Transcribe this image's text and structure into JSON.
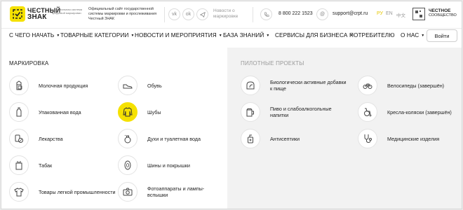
{
  "header": {
    "logo_text_line1": "ЧЕСТНЫЙ",
    "logo_text_line2": "ЗНАК",
    "logo_sub": "национальная система цифровой маркировки",
    "tagline": "Официальный сайт государственной системы маркировки и прослеживания Честный ЗНАК",
    "news_text": "Новости о маркировке",
    "phone": "8 800 222 1523",
    "email": "support@crpt.ru",
    "lang_ru": "РУ",
    "lang_en": "EN",
    "lang_zh": "中文",
    "cs_line1": "ЧЕСТНОЕ",
    "cs_line2": "СООБЩЕСТВО"
  },
  "nav": {
    "items": [
      "С ЧЕГО НАЧАТЬ",
      "ТОВАРНЫЕ КАТЕГОРИИ",
      "НОВОСТИ И МЕРОПРИЯТИЯ",
      "БАЗА ЗНАНИЙ",
      "СЕРВИСЫ ДЛЯ БИЗНЕСА",
      "ПОТРЕБИТЕЛЮ",
      "О НАС"
    ],
    "login": "Войти"
  },
  "left": {
    "title": "МАРКИРОВКА",
    "col1": [
      {
        "label": "Молочная продукция",
        "icon": "milk-icon"
      },
      {
        "label": "Упакованная вода",
        "icon": "water-bottle-icon"
      },
      {
        "label": "Лекарства",
        "icon": "medicine-icon"
      },
      {
        "label": "Табак",
        "icon": "tobacco-icon"
      },
      {
        "label": "Товары легкой промышленности",
        "icon": "tshirt-icon"
      }
    ],
    "col2": [
      {
        "label": "Обувь",
        "icon": "shoe-icon"
      },
      {
        "label": "Шубы",
        "icon": "fur-coat-icon"
      },
      {
        "label": "Духи и туалетная вода",
        "icon": "perfume-icon"
      },
      {
        "label": "Шины и покрышки",
        "icon": "tire-icon"
      },
      {
        "label": "Фотоаппараты и лампы-вспышки",
        "icon": "camera-icon"
      }
    ]
  },
  "right": {
    "title": "ПИЛОТНЫЕ ПРОЕКТЫ",
    "col1": [
      {
        "label": "Биологически активные добавки к пище",
        "icon": "supplement-icon"
      },
      {
        "label": "Пиво и слабоалкогольные напитки",
        "icon": "beer-icon"
      },
      {
        "label": "Антисептики",
        "icon": "antiseptic-icon"
      }
    ],
    "col2": [
      {
        "label": "Велосипеды (завершён)",
        "icon": "bicycle-icon"
      },
      {
        "label": "Кресла-коляски (завершён)",
        "icon": "wheelchair-icon"
      },
      {
        "label": "Медицинские изделия",
        "icon": "stethoscope-icon"
      }
    ]
  },
  "colors": {
    "accent": "#f5e100",
    "right_bg": "#f2f2f2"
  }
}
